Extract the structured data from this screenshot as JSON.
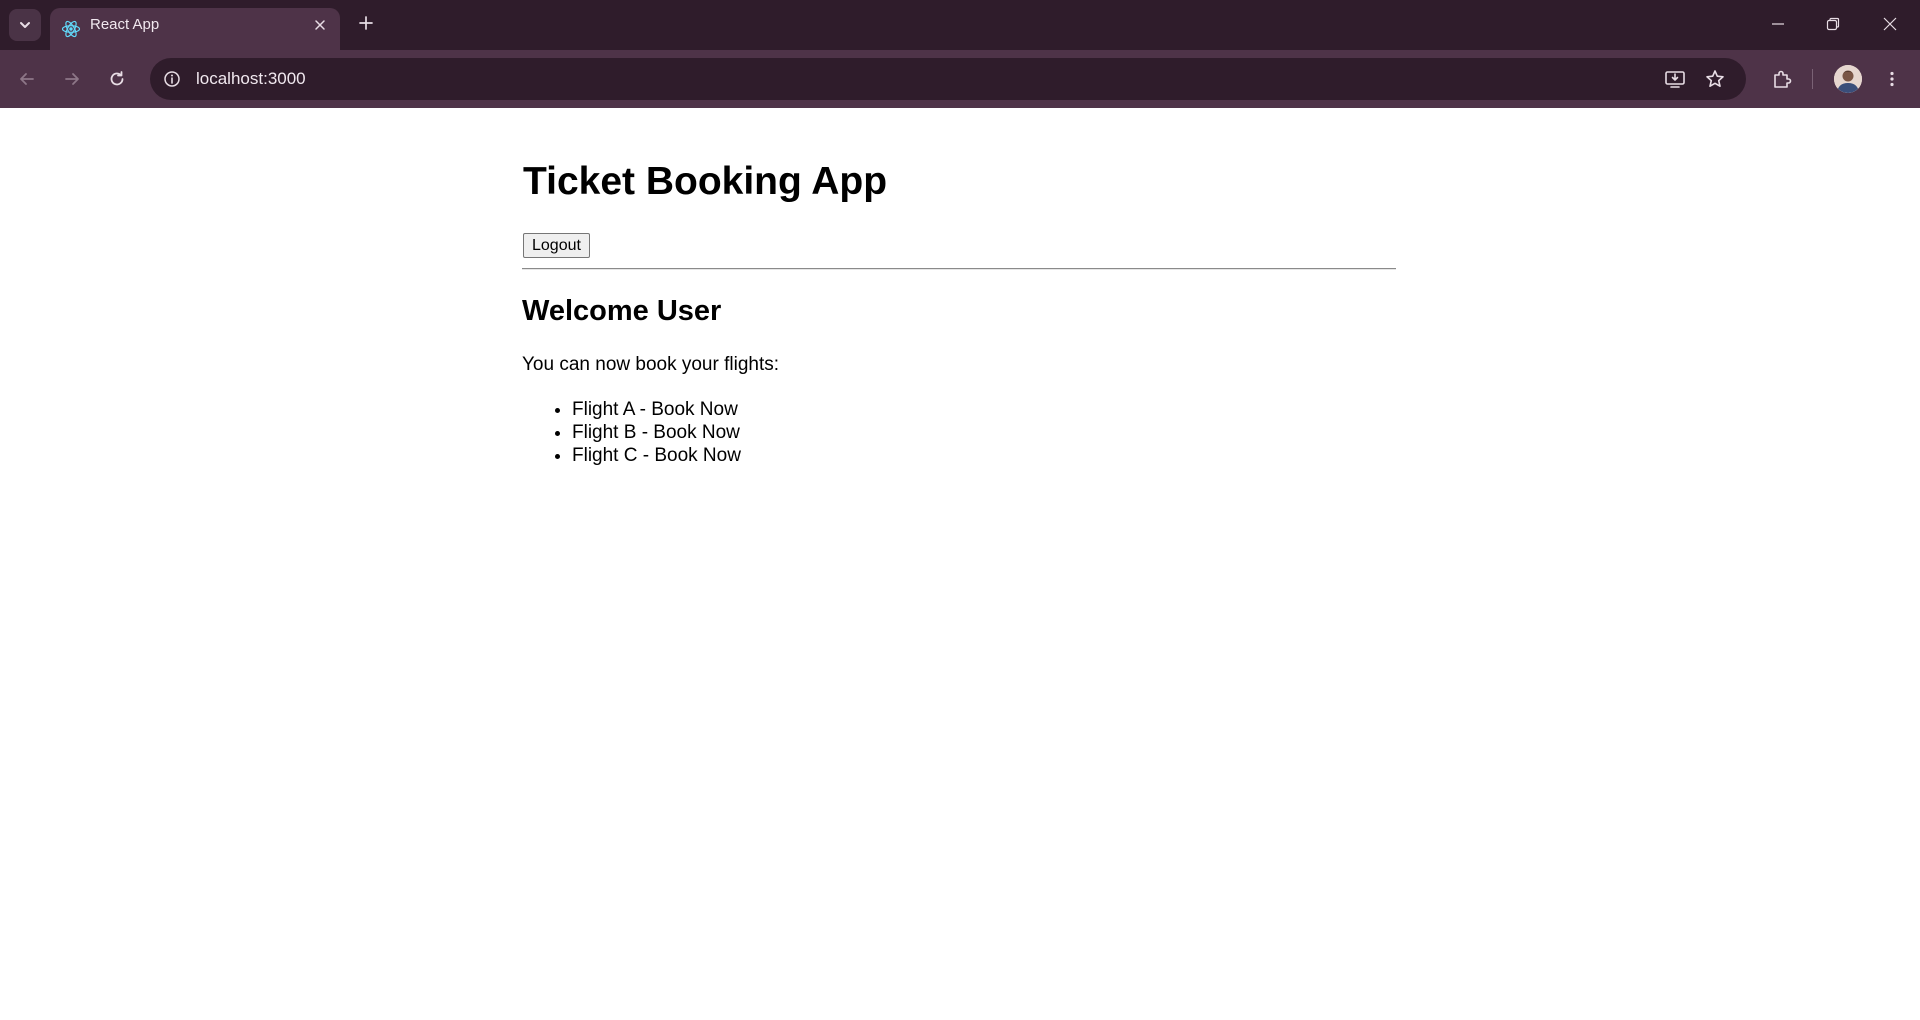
{
  "browser": {
    "tab_title": "React App",
    "url": "localhost:3000",
    "colors": {
      "frame": "#2f1c2b",
      "toolbar": "#4e3348",
      "icon": "#e8dde5"
    }
  },
  "app": {
    "title": "Ticket Booking App",
    "logout_label": "Logout",
    "welcome": "Welcome User",
    "intro": "You can now book your flights:",
    "flights": [
      "Flight A - Book Now",
      "Flight B - Book Now",
      "Flight C - Book Now"
    ]
  }
}
